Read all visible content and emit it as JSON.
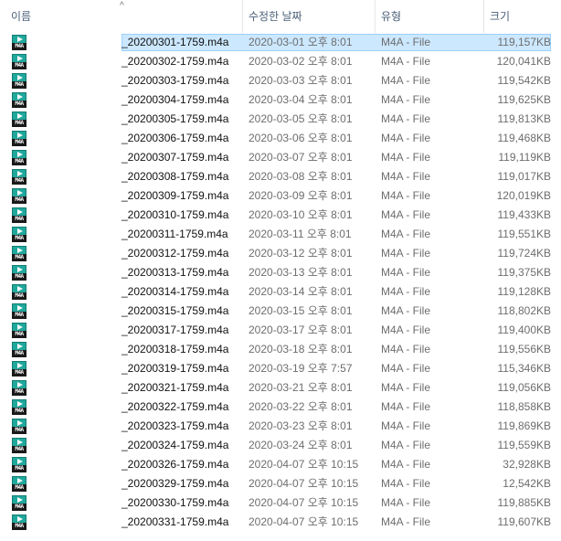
{
  "columns": {
    "name": "이름",
    "date": "수정한 날짜",
    "type": "유형",
    "size": "크기",
    "sort_indicator": "^"
  },
  "icon_label": "M4A",
  "accent_color": "#1fa89c",
  "selection_color": "#cce8ff",
  "files": [
    {
      "name": "_20200301-1759.m4a",
      "date": "2020-03-01 오후 8:01",
      "type": "M4A - File",
      "size": "119,157KB",
      "selected": true
    },
    {
      "name": "_20200302-1759.m4a",
      "date": "2020-03-02 오후 8:01",
      "type": "M4A - File",
      "size": "120,041KB"
    },
    {
      "name": "_20200303-1759.m4a",
      "date": "2020-03-03 오후 8:01",
      "type": "M4A - File",
      "size": "119,542KB"
    },
    {
      "name": "_20200304-1759.m4a",
      "date": "2020-03-04 오후 8:01",
      "type": "M4A - File",
      "size": "119,625KB"
    },
    {
      "name": "_20200305-1759.m4a",
      "date": "2020-03-05 오후 8:01",
      "type": "M4A - File",
      "size": "119,813KB"
    },
    {
      "name": "_20200306-1759.m4a",
      "date": "2020-03-06 오후 8:01",
      "type": "M4A - File",
      "size": "119,468KB"
    },
    {
      "name": "_20200307-1759.m4a",
      "date": "2020-03-07 오후 8:01",
      "type": "M4A - File",
      "size": "119,119KB"
    },
    {
      "name": "_20200308-1759.m4a",
      "date": "2020-03-08 오후 8:01",
      "type": "M4A - File",
      "size": "119,017KB"
    },
    {
      "name": "_20200309-1759.m4a",
      "date": "2020-03-09 오후 8:01",
      "type": "M4A - File",
      "size": "120,019KB"
    },
    {
      "name": "_20200310-1759.m4a",
      "date": "2020-03-10 오후 8:01",
      "type": "M4A - File",
      "size": "119,433KB"
    },
    {
      "name": "_20200311-1759.m4a",
      "date": "2020-03-11 오후 8:01",
      "type": "M4A - File",
      "size": "119,551KB"
    },
    {
      "name": "_20200312-1759.m4a",
      "date": "2020-03-12 오후 8:01",
      "type": "M4A - File",
      "size": "119,724KB"
    },
    {
      "name": "_20200313-1759.m4a",
      "date": "2020-03-13 오후 8:01",
      "type": "M4A - File",
      "size": "119,375KB"
    },
    {
      "name": "_20200314-1759.m4a",
      "date": "2020-03-14 오후 8:01",
      "type": "M4A - File",
      "size": "119,128KB"
    },
    {
      "name": "_20200315-1759.m4a",
      "date": "2020-03-15 오후 8:01",
      "type": "M4A - File",
      "size": "118,802KB"
    },
    {
      "name": "_20200317-1759.m4a",
      "date": "2020-03-17 오후 8:01",
      "type": "M4A - File",
      "size": "119,400KB"
    },
    {
      "name": "_20200318-1759.m4a",
      "date": "2020-03-18 오후 8:01",
      "type": "M4A - File",
      "size": "119,556KB"
    },
    {
      "name": "_20200319-1759.m4a",
      "date": "2020-03-19 오후 7:57",
      "type": "M4A - File",
      "size": "115,346KB"
    },
    {
      "name": "_20200321-1759.m4a",
      "date": "2020-03-21 오후 8:01",
      "type": "M4A - File",
      "size": "119,056KB"
    },
    {
      "name": "_20200322-1759.m4a",
      "date": "2020-03-22 오후 8:01",
      "type": "M4A - File",
      "size": "118,858KB"
    },
    {
      "name": "_20200323-1759.m4a",
      "date": "2020-03-23 오후 8:01",
      "type": "M4A - File",
      "size": "119,869KB"
    },
    {
      "name": "_20200324-1759.m4a",
      "date": "2020-03-24 오후 8:01",
      "type": "M4A - File",
      "size": "119,559KB"
    },
    {
      "name": "_20200326-1759.m4a",
      "date": "2020-04-07 오후 10:15",
      "type": "M4A - File",
      "size": "32,928KB"
    },
    {
      "name": "_20200329-1759.m4a",
      "date": "2020-04-07 오후 10:15",
      "type": "M4A - File",
      "size": "12,542KB"
    },
    {
      "name": "_20200330-1759.m4a",
      "date": "2020-04-07 오후 10:15",
      "type": "M4A - File",
      "size": "119,885KB"
    },
    {
      "name": "_20200331-1759.m4a",
      "date": "2020-04-07 오후 10:15",
      "type": "M4A - File",
      "size": "119,607KB"
    }
  ]
}
